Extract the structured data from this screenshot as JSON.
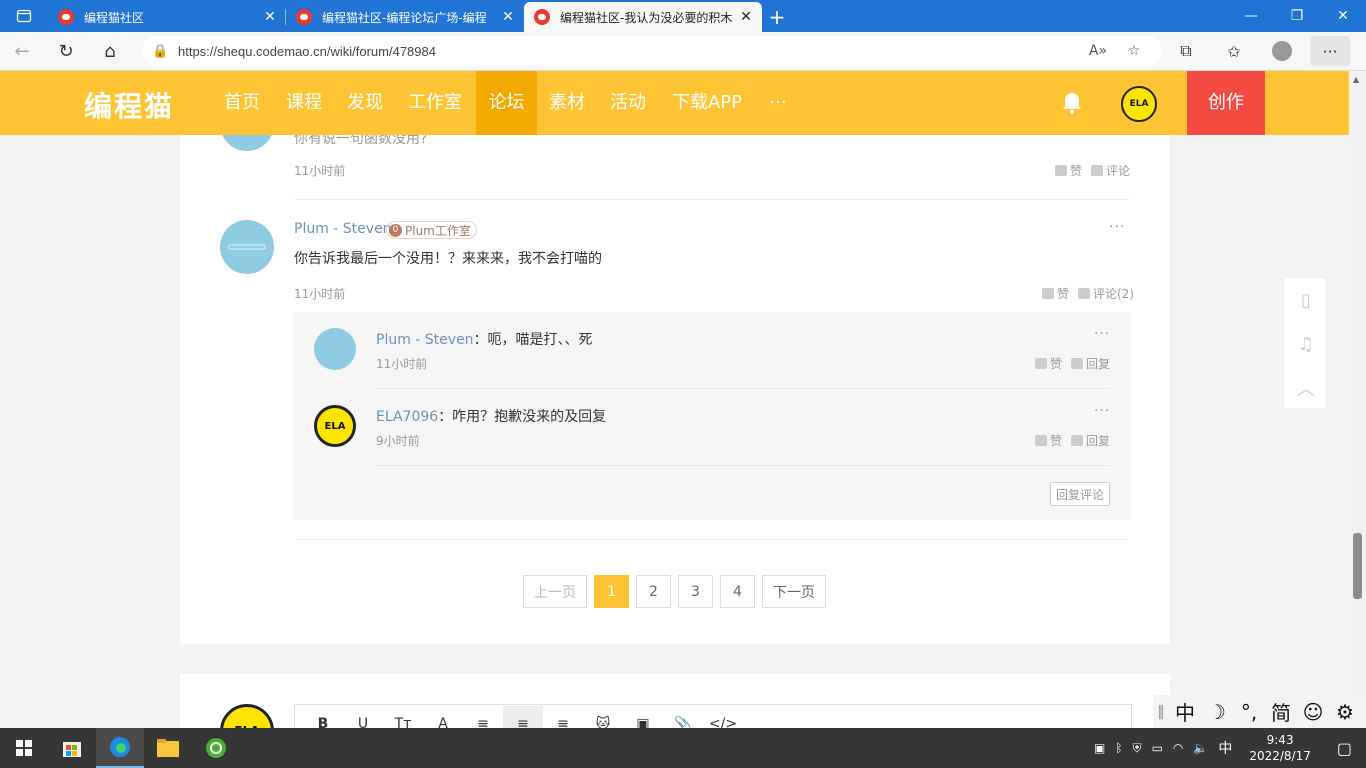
{
  "browser": {
    "tabs": [
      {
        "title": "编程猫社区",
        "active": false
      },
      {
        "title": "编程猫社区-编程论坛广场-编程",
        "active": false
      },
      {
        "title": "编程猫社区-我认为没必要的积木",
        "active": true
      }
    ],
    "new_tab": "+",
    "url": "https://shequ.codemao.cn/wiki/forum/478984"
  },
  "site": {
    "logo": "编程猫",
    "nav": [
      "首页",
      "课程",
      "发现",
      "工作室",
      "论坛",
      "素材",
      "活动",
      "下载APP",
      "···"
    ],
    "active_nav": "论坛",
    "avatar_text": "ELA",
    "create_label": "创作"
  },
  "comments": {
    "prev": {
      "text_partial": "你有说一句函数没用?",
      "time": "11小时前",
      "like_label": "赞",
      "comment_label": "评论"
    },
    "main": {
      "username": "Plum - Steven",
      "badge_level": "0",
      "badge_label": "Plum工作室",
      "text": "你告诉我最后一个没用！？来来来，我不会打喵的",
      "time": "11小时前",
      "like_label": "赞",
      "comment_label": "评论(2)",
      "replies": [
        {
          "name": "Plum - Steven",
          "text": "：呃，喵是打、、死",
          "time": "11小时前",
          "like_label": "赞",
          "reply_label": "回复"
        },
        {
          "name": "ELA7096",
          "text": "：咋用？抱歉没来的及回复",
          "time": "9小时前",
          "like_label": "赞",
          "reply_label": "回复"
        }
      ],
      "reply_comment_button": "回复评论"
    }
  },
  "pager": {
    "prev": "上一页",
    "pages": [
      "1",
      "2",
      "3",
      "4"
    ],
    "current": "1",
    "next": "下一页"
  },
  "editor": {
    "tools": [
      "B",
      "U",
      "Tт",
      "A",
      "≡",
      "≡",
      "≡",
      "🐱",
      "▣",
      "📎",
      "</>"
    ],
    "avatar_text": "ELA"
  },
  "ime": [
    "中",
    "☽",
    "°,",
    "简",
    "☺",
    "⚙"
  ],
  "taskbar": {
    "tray_lang": "中",
    "time": "9:43",
    "date": "2022/8/17"
  },
  "colors": {
    "header_yellow": "#fec433",
    "nav_active": "#f2a900",
    "create_red": "#f34b41",
    "link_blue": "#6c92b8",
    "browser_blue": "#1f74d6"
  }
}
